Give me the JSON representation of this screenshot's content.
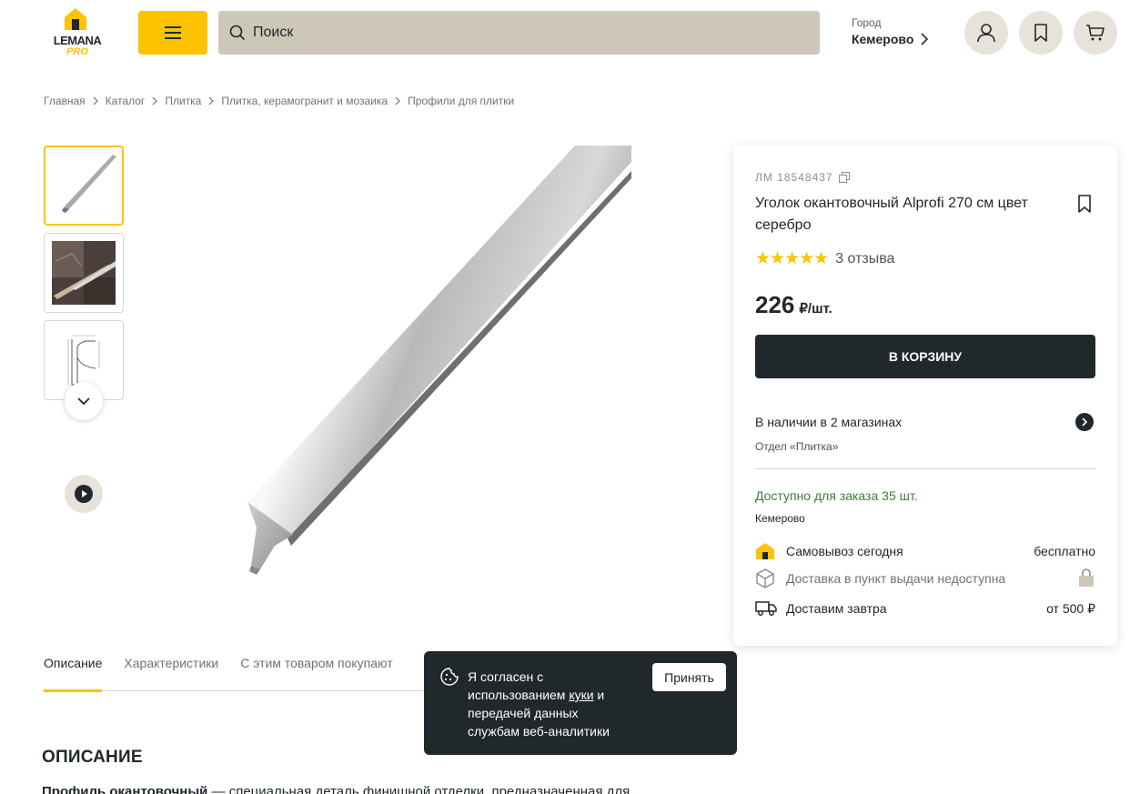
{
  "header": {
    "logo_brand": "LEMANA",
    "logo_sub": "PRO",
    "search_placeholder": "Поиск",
    "city_label": "Город",
    "city_name": "Кемерово"
  },
  "breadcrumbs": [
    "Главная",
    "Каталог",
    "Плитка",
    "Плитка, керамогранит и мозаика",
    "Профили для плитки"
  ],
  "product": {
    "sku": "ЛМ 18548437",
    "title": "Уголок окантовочный Alprofi 270 см цвет серебро",
    "stars": "★★★★★",
    "rating": 5,
    "reviews": "3 отзыва",
    "price": "226",
    "price_unit": "₽/шт.",
    "cart_button": "В КОРЗИНУ",
    "stock": "В наличии в 2 магазинах",
    "department": "Отдел «Плитка»",
    "available": "Доступно для заказа 35 шт.",
    "available_city": "Кемерово",
    "delivery": [
      {
        "icon": "store-house-icon",
        "label": "Самовывоз сегодня",
        "value": "бесплатно"
      },
      {
        "icon": "box-icon",
        "label": "Доставка в пункт выдачи недоступна",
        "value": ""
      },
      {
        "icon": "truck-icon",
        "label": "Доставим завтра",
        "value": "от 500 ₽"
      }
    ]
  },
  "tabs": [
    "Описание",
    "Характеристики",
    "С этим товаром покупают"
  ],
  "description": {
    "section_title": "ОПИСАНИЕ",
    "lead_bold": "Профиль окантовочный",
    "lead_text": " — специальная деталь финишной отделки, предназначенная для"
  },
  "cookie": {
    "text_before": "Я согласен с использованием ",
    "link": "куки",
    "text_after": " и передачей данных службам веб-аналитики",
    "accept": "Принять"
  },
  "colors": {
    "accent": "#fdc300",
    "dark": "#21282b",
    "search_bg": "#cdc7b8",
    "success": "#3a7f34"
  }
}
